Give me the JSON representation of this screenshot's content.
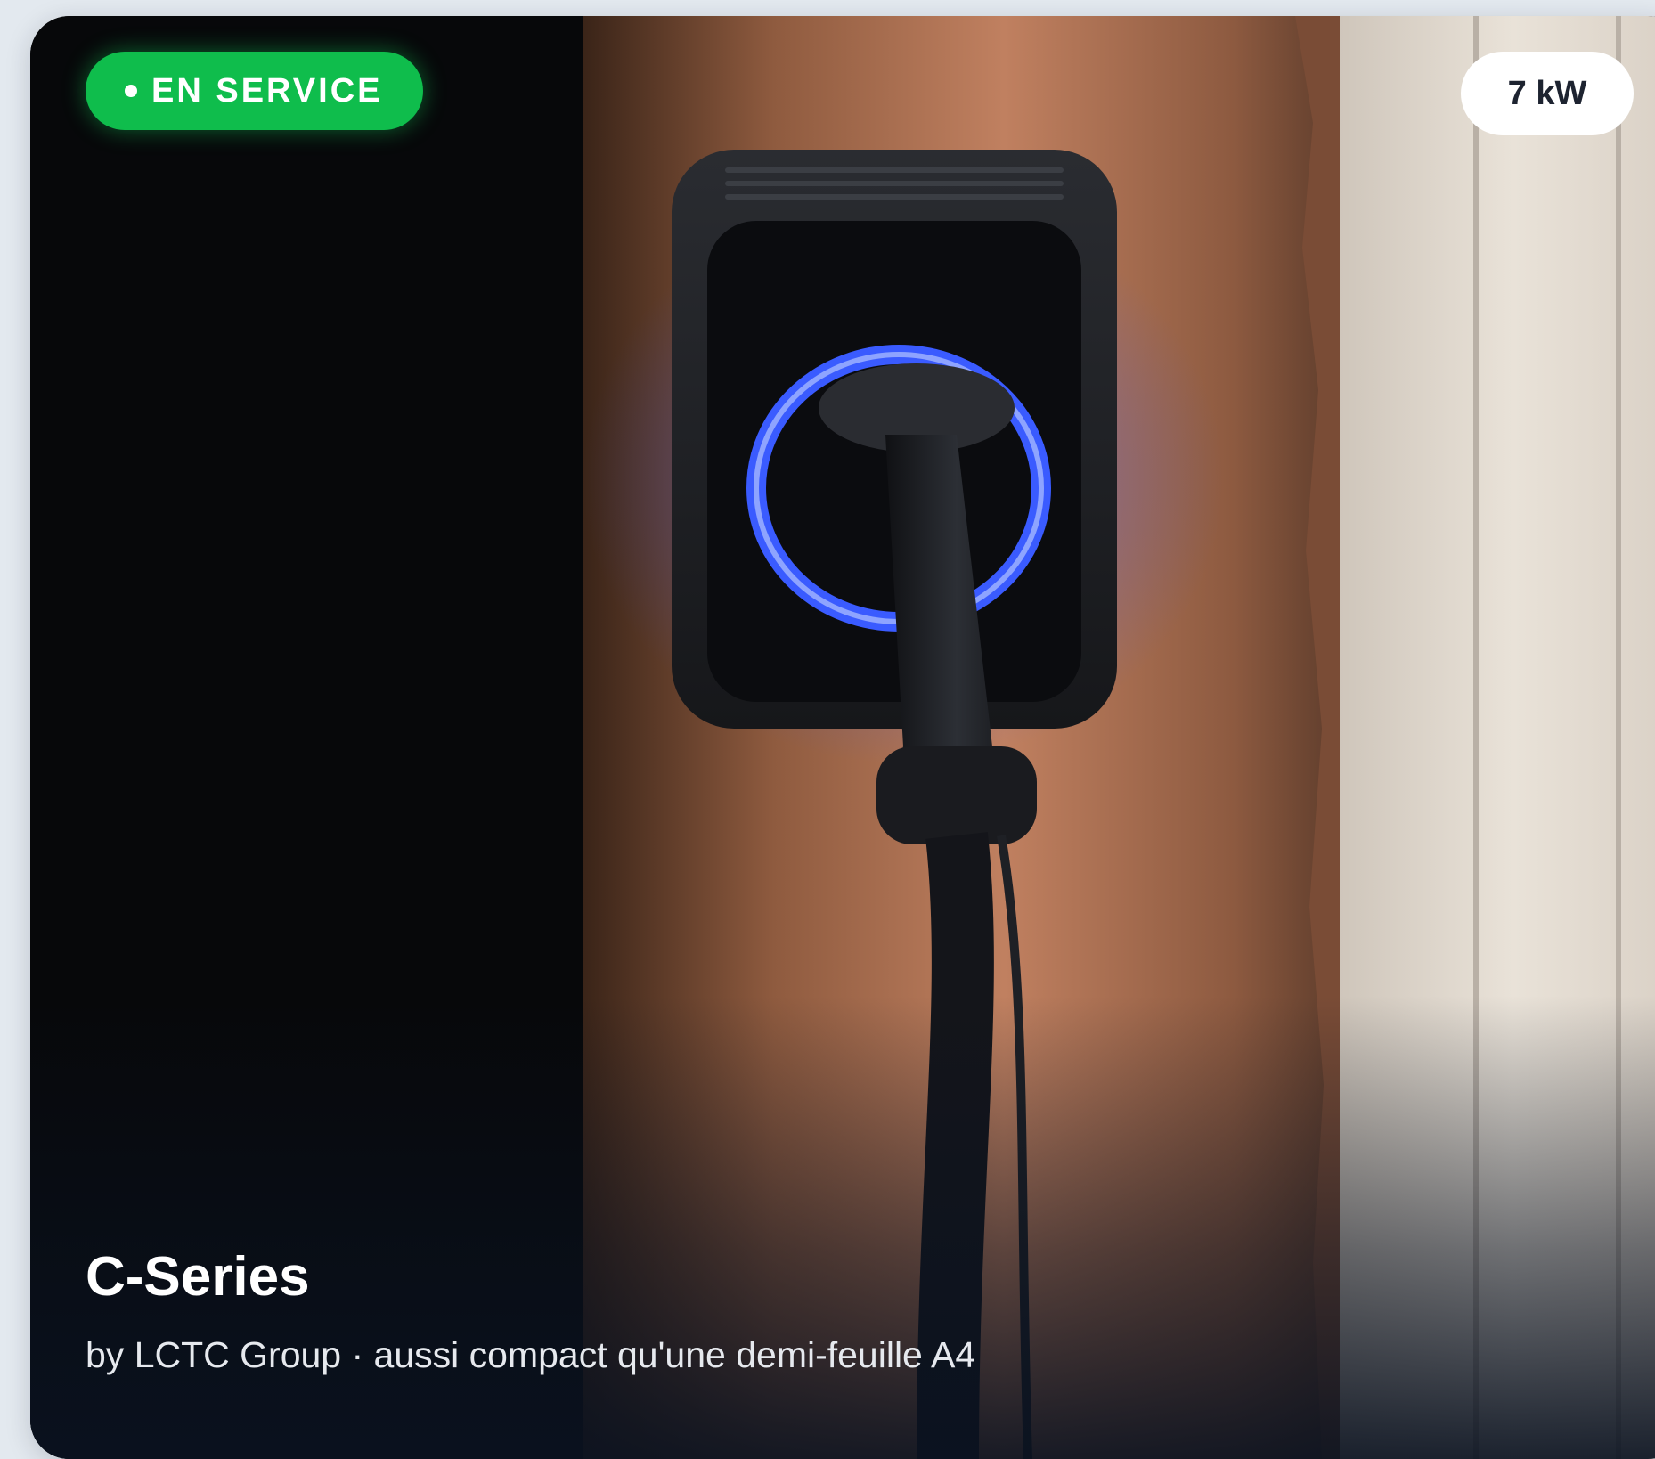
{
  "card": {
    "status_label": "EN SERVICE",
    "power_label": "7 kW",
    "title": "C-Series",
    "subtitle": "by LCTC Group · aussi compact qu'une demi-feuille A4"
  },
  "colors": {
    "status_green": "#0fbd4c",
    "ring_glow": "#2b4dff",
    "wall": "#b77a57"
  },
  "icons": {
    "status": "status-dot-icon"
  }
}
